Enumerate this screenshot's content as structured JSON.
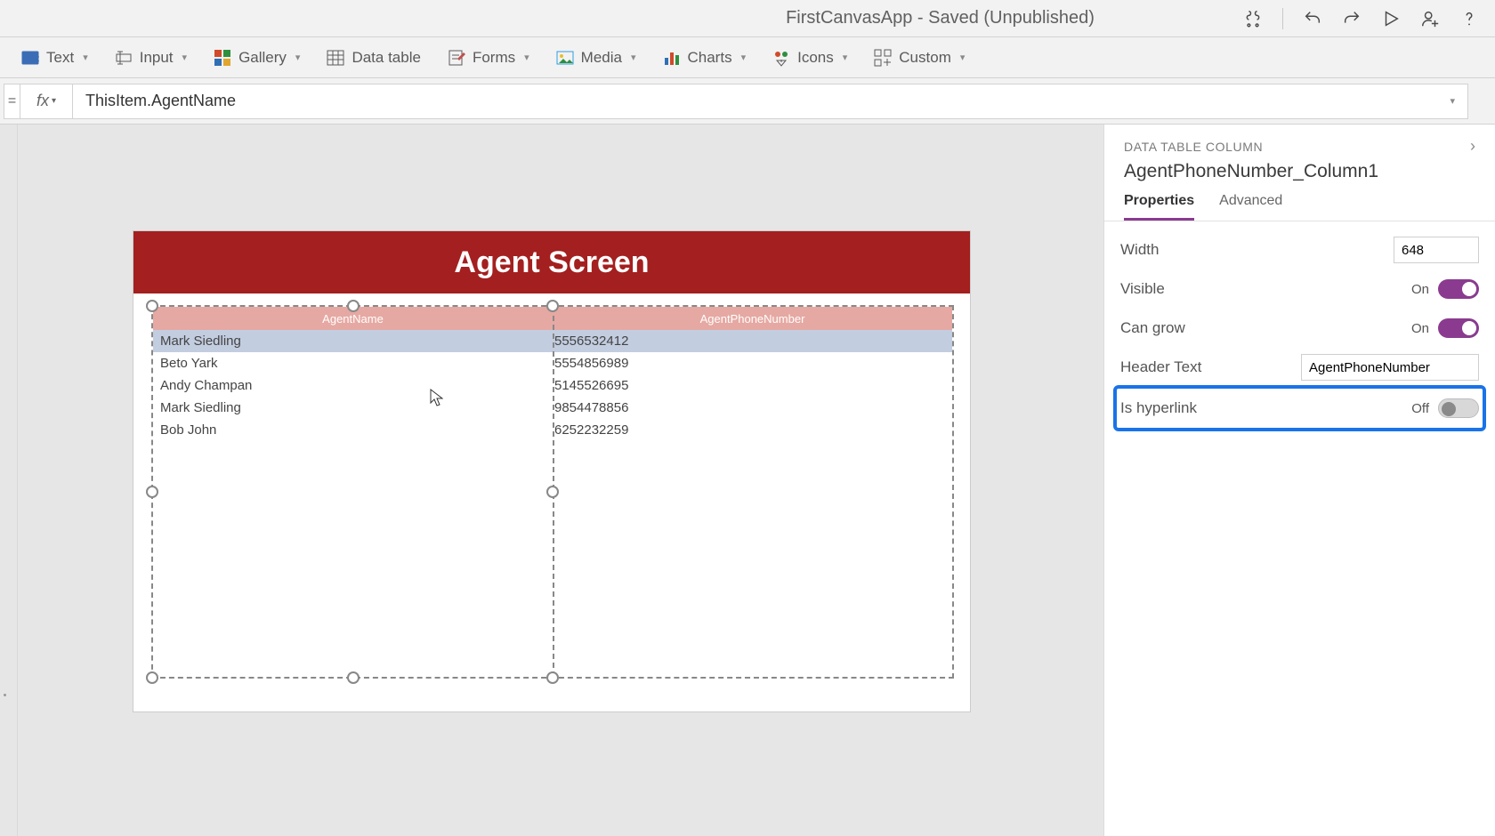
{
  "titlebar": {
    "app_title": "FirstCanvasApp - Saved (Unpublished)"
  },
  "ribbon": {
    "text": "Text",
    "input": "Input",
    "gallery": "Gallery",
    "data_table": "Data table",
    "forms": "Forms",
    "media": "Media",
    "charts": "Charts",
    "icons": "Icons",
    "custom": "Custom"
  },
  "formula": {
    "eq": "=",
    "fx": "fx",
    "value": "ThisItem.AgentName"
  },
  "canvas": {
    "banner": "Agent Screen",
    "columns": [
      "AgentName",
      "AgentPhoneNumber"
    ],
    "rows": [
      {
        "name": "Mark Siedling",
        "phone": "5556532412",
        "selected": true
      },
      {
        "name": "Beto Yark",
        "phone": "5554856989"
      },
      {
        "name": "Andy Champan",
        "phone": "5145526695"
      },
      {
        "name": "Mark Siedling",
        "phone": "9854478856"
      },
      {
        "name": "Bob John",
        "phone": "6252232259"
      }
    ]
  },
  "props": {
    "section": "DATA TABLE COLUMN",
    "name": "AgentPhoneNumber_Column1",
    "tabs": {
      "properties": "Properties",
      "advanced": "Advanced"
    },
    "width": {
      "label": "Width",
      "value": "648"
    },
    "visible": {
      "label": "Visible",
      "state": "On"
    },
    "can_grow": {
      "label": "Can grow",
      "state": "On"
    },
    "header_text": {
      "label": "Header Text",
      "value": "AgentPhoneNumber"
    },
    "is_hyperlink": {
      "label": "Is hyperlink",
      "state": "Off"
    }
  }
}
